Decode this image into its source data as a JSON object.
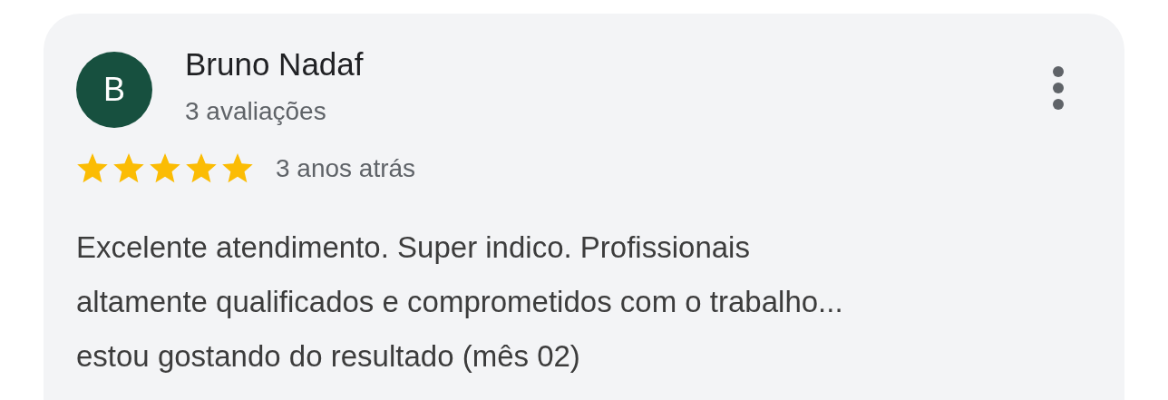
{
  "review": {
    "author": {
      "initial": "B",
      "name": "Bruno Nadaf",
      "review_count": "3 avaliações"
    },
    "stars": 5,
    "time": "3 anos atrás",
    "text_lines": [
      "Excelente atendimento. Super indico. Profissionais",
      "altamente qualificados e comprometidos com o trabalho...",
      "estou gostando do resultado (mês 02)"
    ]
  }
}
